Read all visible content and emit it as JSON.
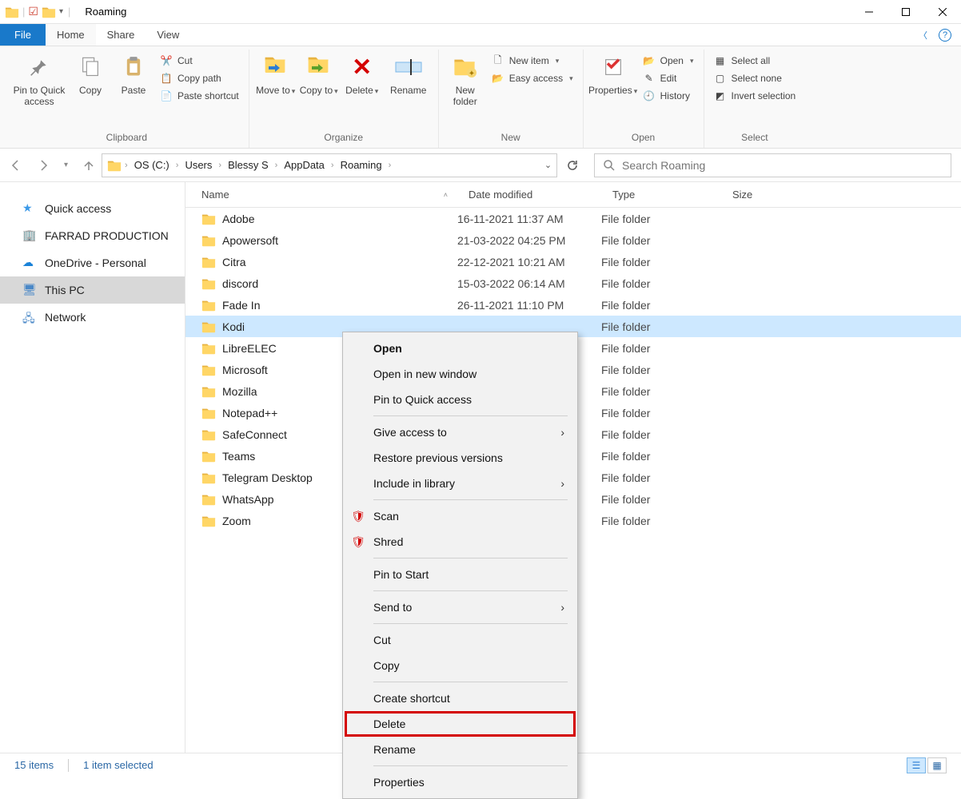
{
  "window": {
    "title": "Roaming"
  },
  "tabs": {
    "file": "File",
    "home": "Home",
    "share": "Share",
    "view": "View"
  },
  "ribbon": {
    "clipboard": {
      "label": "Clipboard",
      "pin_to_quick": "Pin to Quick access",
      "copy": "Copy",
      "paste": "Paste",
      "cut": "Cut",
      "copy_path": "Copy path",
      "paste_shortcut": "Paste shortcut"
    },
    "organize": {
      "label": "Organize",
      "move_to": "Move to",
      "copy_to": "Copy to",
      "delete": "Delete",
      "rename": "Rename"
    },
    "new": {
      "label": "New",
      "new_folder": "New folder",
      "new_item": "New item",
      "easy_access": "Easy access"
    },
    "open": {
      "label": "Open",
      "properties": "Properties",
      "open": "Open",
      "edit": "Edit",
      "history": "History"
    },
    "select": {
      "label": "Select",
      "select_all": "Select all",
      "select_none": "Select none",
      "invert": "Invert selection"
    }
  },
  "breadcrumbs": [
    "OS (C:)",
    "Users",
    "Blessy S",
    "AppData",
    "Roaming"
  ],
  "search": {
    "placeholder": "Search Roaming"
  },
  "nav_pane": {
    "quick_access": "Quick access",
    "farrad": "FARRAD PRODUCTION",
    "onedrive": "OneDrive - Personal",
    "this_pc": "This PC",
    "network": "Network"
  },
  "columns": {
    "name": "Name",
    "modified": "Date modified",
    "type": "Type",
    "size": "Size"
  },
  "rows": [
    {
      "name": "Adobe",
      "modified": "16-11-2021 11:37 AM",
      "type": "File folder"
    },
    {
      "name": "Apowersoft",
      "modified": "21-03-2022 04:25 PM",
      "type": "File folder"
    },
    {
      "name": "Citra",
      "modified": "22-12-2021 10:21 AM",
      "type": "File folder"
    },
    {
      "name": "discord",
      "modified": "15-03-2022 06:14 AM",
      "type": "File folder"
    },
    {
      "name": "Fade In",
      "modified": "26-11-2021 11:10 PM",
      "type": "File folder"
    },
    {
      "name": "Kodi",
      "modified": "",
      "type": "File folder",
      "selected": true
    },
    {
      "name": "LibreELEC",
      "modified": "",
      "type": "File folder"
    },
    {
      "name": "Microsoft",
      "modified": "",
      "type": "File folder"
    },
    {
      "name": "Mozilla",
      "modified": "",
      "type": "File folder"
    },
    {
      "name": "Notepad++",
      "modified": "",
      "type": "File folder"
    },
    {
      "name": "SafeConnect",
      "modified": "",
      "type": "File folder"
    },
    {
      "name": "Teams",
      "modified": "",
      "type": "File folder"
    },
    {
      "name": "Telegram Desktop",
      "modified": "",
      "type": "File folder"
    },
    {
      "name": "WhatsApp",
      "modified": "",
      "type": "File folder"
    },
    {
      "name": "Zoom",
      "modified": "",
      "type": "File folder"
    }
  ],
  "context_menu": {
    "open": "Open",
    "open_new_window": "Open in new window",
    "pin_quick": "Pin to Quick access",
    "give_access": "Give access to",
    "restore_prev": "Restore previous versions",
    "include_library": "Include in library",
    "scan": "Scan",
    "shred": "Shred",
    "pin_start": "Pin to Start",
    "send_to": "Send to",
    "cut": "Cut",
    "copy": "Copy",
    "create_shortcut": "Create shortcut",
    "delete": "Delete",
    "rename": "Rename",
    "properties": "Properties"
  },
  "statusbar": {
    "count": "15 items",
    "selection": "1 item selected"
  }
}
